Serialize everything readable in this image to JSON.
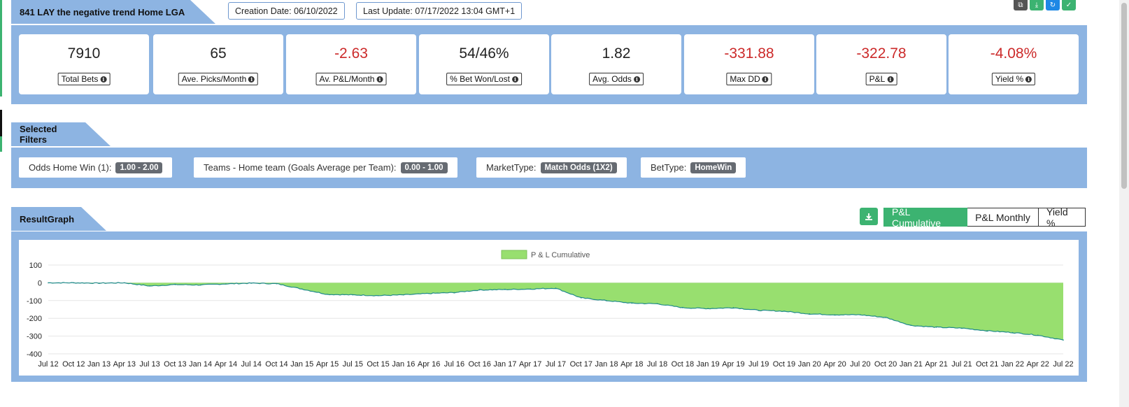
{
  "header": {
    "title": "841 LAY the negative trend Home LGA",
    "creation_date": "Creation Date: 06/10/2022",
    "last_update": "Last Update: 07/17/2022 13:04 GMT+1",
    "icons": [
      "copy-icon",
      "download-icon",
      "refresh-icon",
      "check-icon"
    ]
  },
  "stats": [
    {
      "value": "7910",
      "label": "Total Bets",
      "negative": false
    },
    {
      "value": "65",
      "label": "Ave. Picks/Month",
      "negative": false
    },
    {
      "value": "-2.63",
      "label": "Av. P&L/Month",
      "negative": true
    },
    {
      "value": "54/46%",
      "label": "% Bet Won/Lost",
      "negative": false
    },
    {
      "value": "1.82",
      "label": "Avg. Odds",
      "negative": false
    },
    {
      "value": "-331.88",
      "label": "Max DD",
      "negative": true
    },
    {
      "value": "-322.78",
      "label": "P&L",
      "negative": true
    },
    {
      "value": "-4.08%",
      "label": "Yield %",
      "negative": true
    }
  ],
  "filters": {
    "title": "Selected Filters",
    "items": [
      {
        "label": "Odds Home Win (1):",
        "value": "1.00 - 2.00"
      },
      {
        "label": "Teams - Home team (Goals Average per Team):",
        "value": "0.00 - 1.00"
      },
      {
        "label": "MarketType:",
        "value": "Match Odds (1X2)"
      },
      {
        "label": "BetType:",
        "value": "HomeWin"
      }
    ]
  },
  "graph": {
    "title": "ResultGraph",
    "buttons": {
      "cumulative": "P&L Cumulative",
      "monthly": "P&L Monthly",
      "yield": "Yield %"
    },
    "active": "cumulative"
  },
  "colors": {
    "accent": "#3cb371",
    "band": "#8db4e2",
    "negative": "#cc2a2a",
    "area": "#98df6f",
    "line": "#1f8a8a"
  },
  "chart_data": {
    "type": "area",
    "legend": "P & L Cumulative",
    "legend_position": "top-center",
    "grid": true,
    "ylim": [
      -400,
      100
    ],
    "yticks": [
      100,
      0,
      -100,
      -200,
      -300,
      -400
    ],
    "xticks": [
      "Jul 12",
      "Oct 12",
      "Jan 13",
      "Apr 13",
      "Jul 13",
      "Oct 13",
      "Jan 14",
      "Apr 14",
      "Jul 14",
      "Oct 14",
      "Jan 15",
      "Apr 15",
      "Jul 15",
      "Oct 15",
      "Jan 16",
      "Apr 16",
      "Jul 16",
      "Oct 16",
      "Jan 17",
      "Apr 17",
      "Jul 17",
      "Oct 17",
      "Jan 18",
      "Apr 18",
      "Jul 18",
      "Oct 18",
      "Jan 19",
      "Apr 19",
      "Jul 19",
      "Oct 19",
      "Jan 20",
      "Apr 20",
      "Jul 20",
      "Oct 20",
      "Jan 21",
      "Apr 21",
      "Jul 21",
      "Oct 21",
      "Jan 22",
      "Apr 22",
      "Jul 22"
    ],
    "series": [
      {
        "name": "P & L Cumulative",
        "x": [
          "Jul 12",
          "Oct 12",
          "Jan 13",
          "Apr 13",
          "Jul 13",
          "Oct 13",
          "Jan 14",
          "Apr 14",
          "Jul 14",
          "Oct 14",
          "Jan 15",
          "Apr 15",
          "Jul 15",
          "Oct 15",
          "Jan 16",
          "Apr 16",
          "Jul 16",
          "Oct 16",
          "Jan 17",
          "Apr 17",
          "Jul 17",
          "Oct 17",
          "Jan 18",
          "Apr 18",
          "Jul 18",
          "Oct 18",
          "Jan 19",
          "Apr 19",
          "Jul 19",
          "Oct 19",
          "Jan 20",
          "Apr 20",
          "Jul 20",
          "Oct 20",
          "Jan 21",
          "Apr 21",
          "Jul 21",
          "Oct 21",
          "Jan 22",
          "Apr 22",
          "Jul 22"
        ],
        "values": [
          0,
          0,
          -2,
          0,
          -18,
          -10,
          -12,
          -6,
          -2,
          -5,
          -35,
          -65,
          -68,
          -72,
          -68,
          -60,
          -55,
          -40,
          -38,
          -35,
          -30,
          -85,
          -100,
          -115,
          -118,
          -140,
          -145,
          -140,
          -155,
          -160,
          -175,
          -180,
          -180,
          -195,
          -240,
          -250,
          -255,
          -270,
          -280,
          -295,
          -322
        ]
      }
    ]
  }
}
